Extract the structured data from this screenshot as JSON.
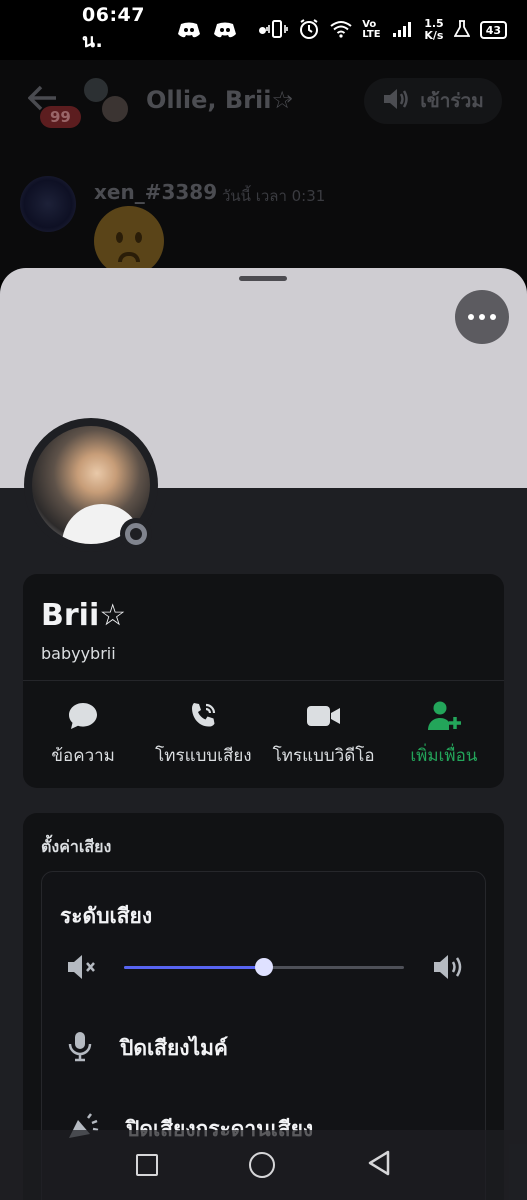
{
  "status_bar": {
    "time": "06:47 น.",
    "left_icons": [
      "discord-icon",
      "discord-icon",
      "dot"
    ],
    "net_speed_value": "1.5",
    "net_speed_unit": "K/s",
    "volte": "Vo LTE",
    "battery": "43"
  },
  "chat": {
    "title": "Ollie, Brii☆",
    "unread_badge": "99",
    "join_label": "เข้าร่วม",
    "message": {
      "author": "xen_#3389",
      "time": "วันนี้ เวลา 0:31"
    }
  },
  "profile": {
    "display_name": "Brii☆",
    "username": "babyybrii",
    "actions": [
      {
        "label": "ข้อความ",
        "icon": "message-icon"
      },
      {
        "label": "โทรแบบเสียง",
        "icon": "phone-icon"
      },
      {
        "label": "โทรแบบวิดีโอ",
        "icon": "video-icon"
      },
      {
        "label": "เพิ่มเพื่อน",
        "icon": "add-friend-icon"
      }
    ]
  },
  "voice_settings": {
    "section_title": "ตั้งค่าเสียง",
    "volume_title": "ระดับเสียง",
    "volume_level": 0.5,
    "mute_mic_label": "ปิดเสียงไมค์",
    "mute_soundboard_label": "ปิดเสียงกระดานเสียง"
  },
  "colors": {
    "accent": "#5865f2",
    "green": "#23a55a",
    "banner": "#cfcdd2"
  }
}
